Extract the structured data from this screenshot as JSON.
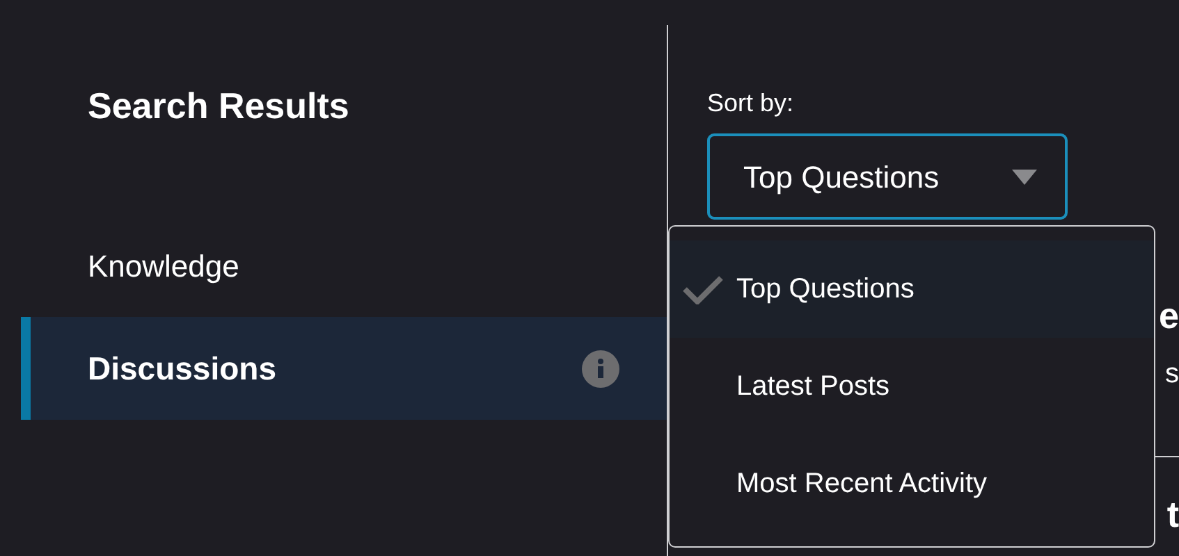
{
  "sidebar": {
    "title": "Search Results",
    "items": [
      {
        "label": "Knowledge",
        "selected": false,
        "info": false
      },
      {
        "label": "Discussions",
        "selected": true,
        "info": true
      }
    ]
  },
  "sort": {
    "label": "Sort by:",
    "value": "Top Questions",
    "expanded": true,
    "options": [
      {
        "label": "Top Questions",
        "selected": true
      },
      {
        "label": "Latest Posts",
        "selected": false
      },
      {
        "label": "Most Recent Activity",
        "selected": false
      }
    ]
  },
  "results": [
    {
      "title": "e",
      "snippet": "s"
    },
    {
      "title": "t"
    }
  ]
}
